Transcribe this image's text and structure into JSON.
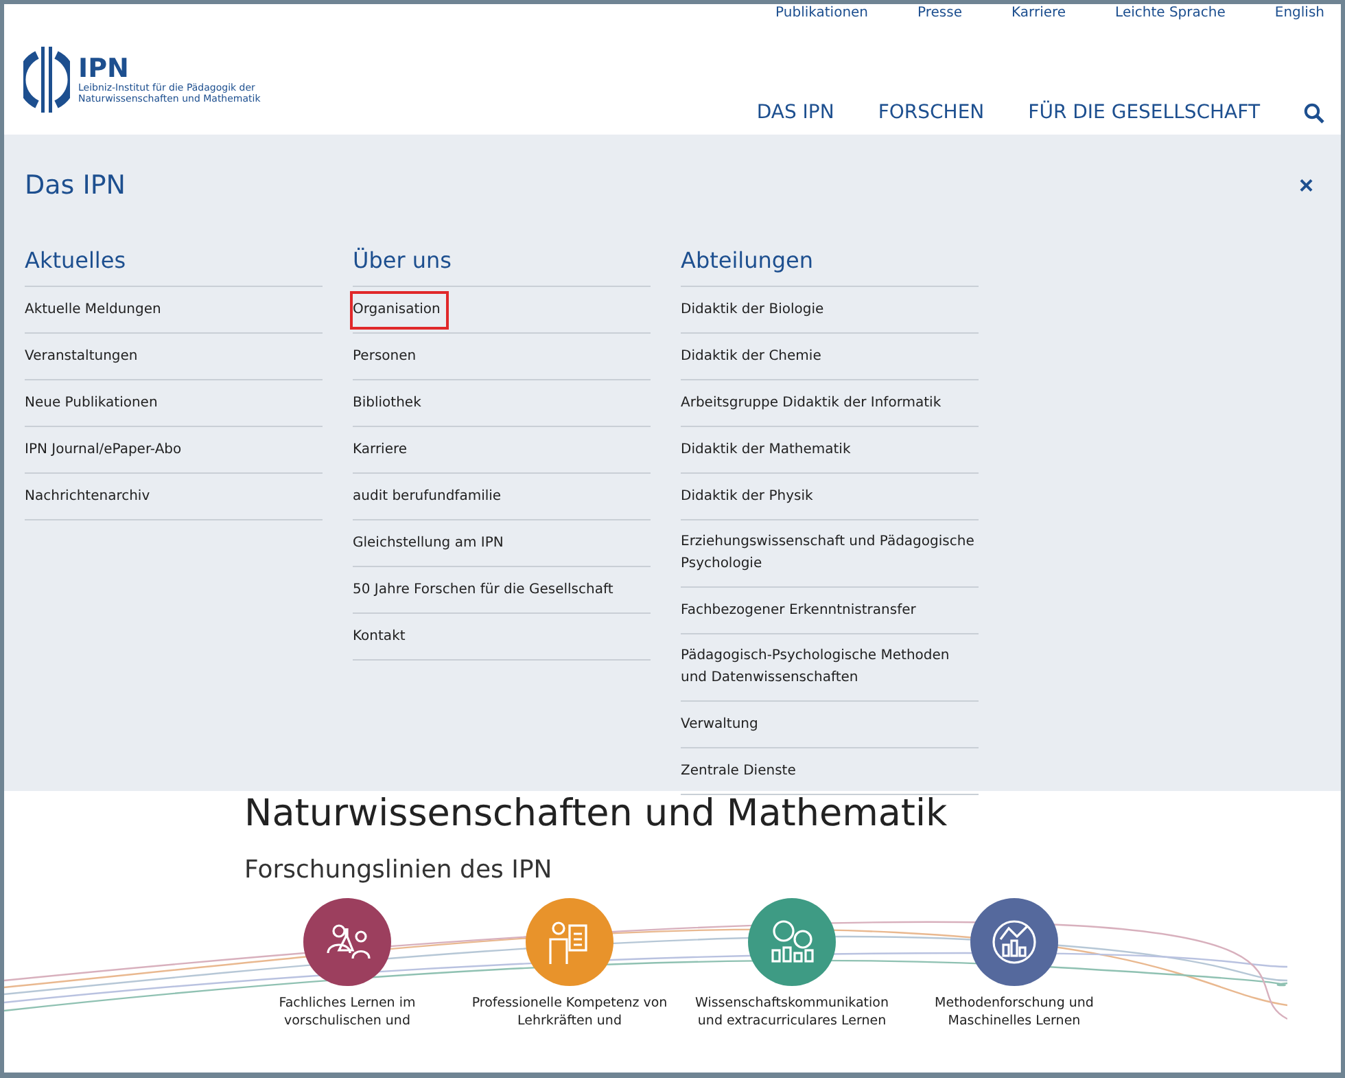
{
  "top_links": [
    "Publikationen",
    "Presse",
    "Karriere",
    "Leichte Sprache",
    "English"
  ],
  "logo": {
    "name": "IPN",
    "subtitle_lines": [
      "Leibniz-Institut für die Pädagogik der",
      "Naturwissenschaften und Mathematik"
    ]
  },
  "main_nav": [
    "DAS IPN",
    "FORSCHEN",
    "FÜR DIE GESELLSCHAFT"
  ],
  "mega_menu": {
    "title": "Das IPN",
    "close": "×",
    "columns": [
      {
        "heading": "Aktuelles",
        "items": [
          {
            "label": "Aktuelle Meldungen",
            "highlighted": false
          },
          {
            "label": "Veranstaltungen",
            "highlighted": false
          },
          {
            "label": "Neue Publikationen",
            "highlighted": false
          },
          {
            "label": "IPN Journal/ePaper-Abo",
            "highlighted": false
          },
          {
            "label": "Nachrichtenarchiv",
            "highlighted": false
          }
        ]
      },
      {
        "heading": "Über uns",
        "items": [
          {
            "label": "Organisation",
            "highlighted": true
          },
          {
            "label": "Personen",
            "highlighted": false
          },
          {
            "label": "Bibliothek",
            "highlighted": false
          },
          {
            "label": "Karriere",
            "highlighted": false
          },
          {
            "label": "audit berufundfamilie",
            "highlighted": false
          },
          {
            "label": "Gleichstellung am IPN",
            "highlighted": false
          },
          {
            "label": "50 Jahre Forschen für die Gesellschaft",
            "highlighted": false
          },
          {
            "label": "Kontakt",
            "highlighted": false
          }
        ]
      },
      {
        "heading": "Abteilungen",
        "items": [
          {
            "label": "Didaktik der Biologie",
            "highlighted": false
          },
          {
            "label": "Didaktik der Chemie",
            "highlighted": false
          },
          {
            "label": "Arbeitsgruppe Didaktik der Informatik",
            "highlighted": false
          },
          {
            "label": "Didaktik der Mathematik",
            "highlighted": false
          },
          {
            "label": "Didaktik der Physik",
            "highlighted": false
          },
          {
            "label": "Erziehungswissenschaft und Pädagogische Psychologie",
            "highlighted": false
          },
          {
            "label": "Fachbezogener Erkenntnistransfer",
            "highlighted": false
          },
          {
            "label": "Pädagogisch-Psychologische Methoden und Datenwissenschaften",
            "highlighted": false
          },
          {
            "label": "Verwaltung",
            "highlighted": false
          },
          {
            "label": "Zentrale Dienste",
            "highlighted": false
          }
        ]
      }
    ]
  },
  "page": {
    "heading": "Naturwissenschaften und Mathematik",
    "section_title": "Forschungslinien des IPN",
    "research_lines": [
      {
        "kind": "people",
        "color": "#9c3f5e",
        "lines": [
          "Fachliches Lernen im",
          "vorschulischen und"
        ]
      },
      {
        "kind": "teacher",
        "color": "#e8932b",
        "lines": [
          "Professionelle Kompetenz von",
          "Lehrkräften und"
        ]
      },
      {
        "kind": "chat",
        "color": "#3e9b84",
        "lines": [
          "Wissenschaftskommunikation",
          "und extracurriculares Lernen"
        ]
      },
      {
        "kind": "analysis",
        "color": "#55699d",
        "lines": [
          "Methodenforschung und",
          "Maschinelles Lernen"
        ]
      }
    ]
  }
}
